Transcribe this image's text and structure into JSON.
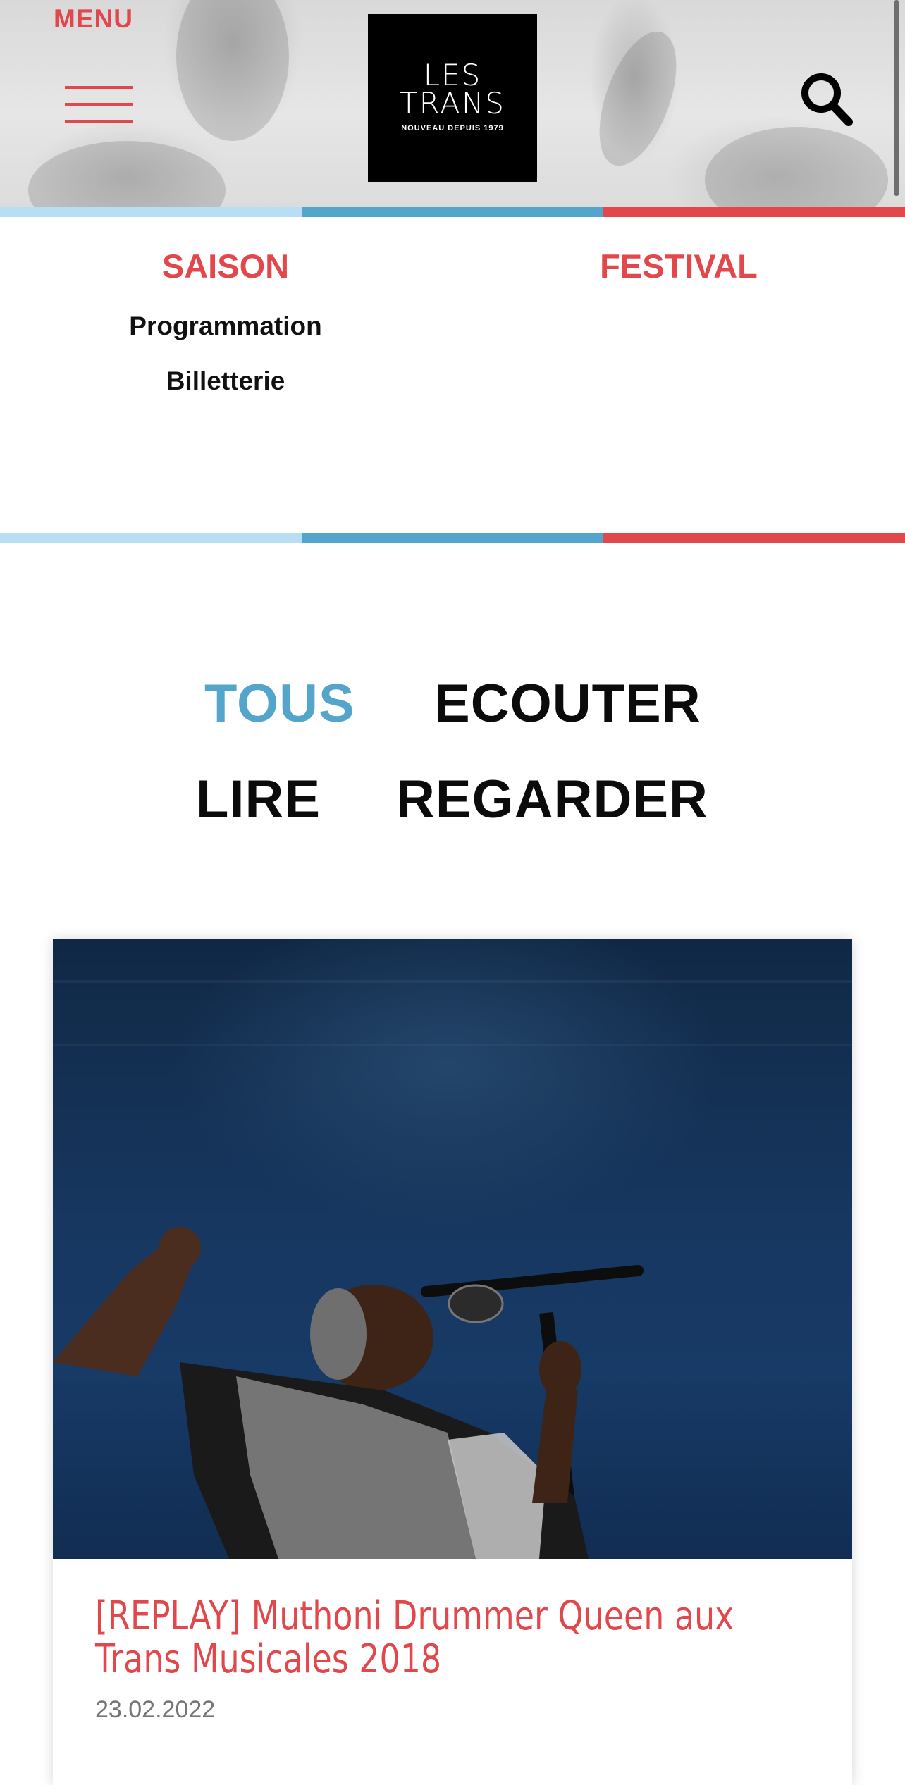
{
  "header": {
    "menu_label": "MENU",
    "logo": {
      "line1": "LES",
      "line2": "TRANS",
      "tagline": "NOUVEAU DEPUIS 1979"
    }
  },
  "nav": {
    "saison": {
      "title": "SAISON",
      "links": [
        "Programmation",
        "Billetterie"
      ]
    },
    "festival": {
      "title": "FESTIVAL"
    }
  },
  "filters": [
    {
      "label": "TOUS",
      "active": true
    },
    {
      "label": "ECOUTER",
      "active": false
    },
    {
      "label": "LIRE",
      "active": false
    },
    {
      "label": "REGARDER",
      "active": false
    }
  ],
  "card": {
    "title_line1": "[REPLAY] Muthoni Drummer Queen aux",
    "title_line2": "Trans Musicales 2018",
    "date": "23.02.2022"
  },
  "colors": {
    "accent_red": "#e2474b",
    "accent_blue": "#54a5cc",
    "light_blue": "#b7def4",
    "text_dark": "#0b0b0b",
    "date_gray": "#757575"
  },
  "icons": [
    "hamburger-icon",
    "search-icon"
  ]
}
